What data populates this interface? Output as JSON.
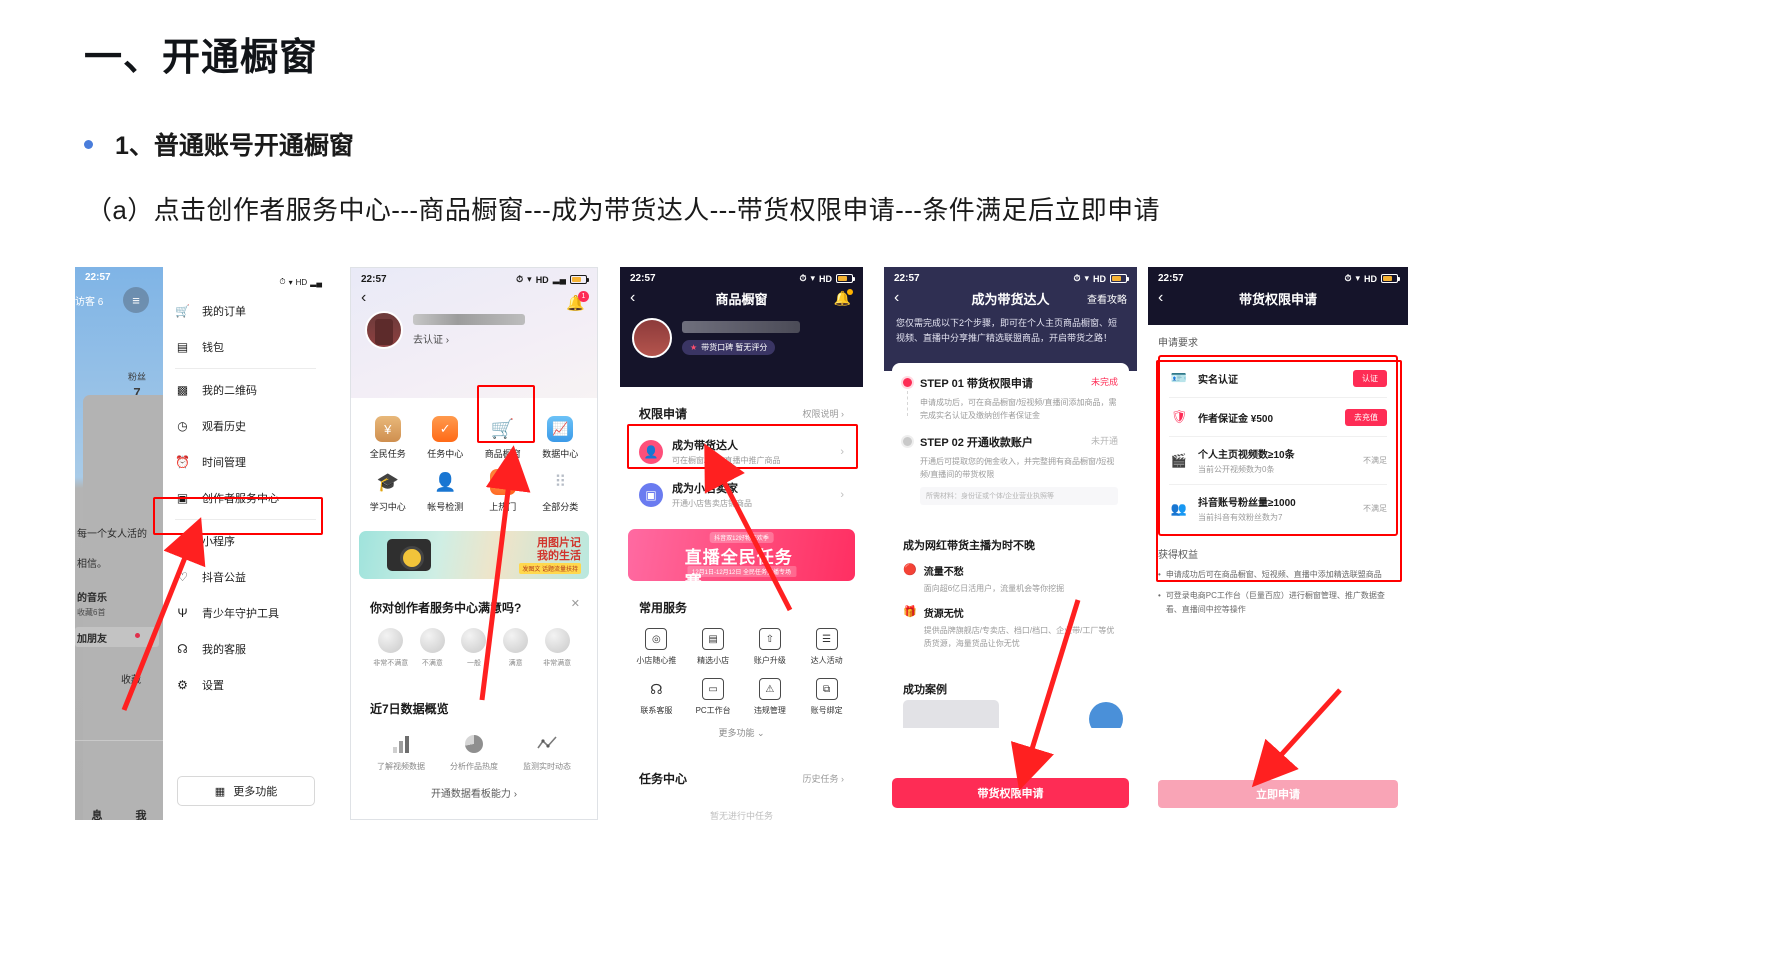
{
  "slide": {
    "title": "一、开通橱窗",
    "bullet": "1、普通账号开通橱窗",
    "subline": "（a）点击创作者服务中心---商品橱窗---成为带货达人---带货权限申请---条件满足后立即申请",
    "accent_color": "#ff0000",
    "bullet_dot_color": "#4a7ddb"
  },
  "phone1": {
    "status_time": "22:57",
    "status_icons": [
      "alarm-icon",
      "wifi-icon",
      "HD",
      "signal-icon",
      "battery-icon"
    ],
    "background": {
      "time": "22:57",
      "visitors": "访客 6",
      "fans_label": "粉丝",
      "fans_count": "7",
      "bio_line1": "每一个女人活的",
      "bio_line2": "相信。",
      "music_title": "的音乐",
      "music_sub": "收藏6首",
      "friends": "加朋友",
      "collect": "收藏",
      "tab_message": "息",
      "tab_me": "我"
    },
    "menu": [
      {
        "label": "我的订单",
        "icon": "cart-icon"
      },
      {
        "label": "钱包",
        "icon": "wallet-icon"
      },
      {
        "label": "我的二维码",
        "icon": "qrcode-icon"
      },
      {
        "label": "观看历史",
        "icon": "history-clock-icon"
      },
      {
        "label": "时间管理",
        "icon": "alarm-clock-icon"
      },
      {
        "label": "创作者服务中心",
        "icon": "chart-box-icon"
      },
      {
        "label": "小程序",
        "icon": "miniprogram-icon"
      },
      {
        "label": "抖音公益",
        "icon": "charity-icon"
      },
      {
        "label": "青少年守护工具",
        "icon": "sprout-icon"
      },
      {
        "label": "我的客服",
        "icon": "headset-icon"
      },
      {
        "label": "设置",
        "icon": "gear-icon"
      }
    ],
    "more_button": "更多功能",
    "more_button_icon": "grid-icon"
  },
  "phone2": {
    "status_time": "22:57",
    "back_icon": "chevron-left-icon",
    "bell_icon": "bell-icon",
    "bell_badge": "1",
    "verify_link": "去认证 ›",
    "grid": [
      {
        "label": "全民任务",
        "icon": "money-stack-icon",
        "color": "#d9a15e"
      },
      {
        "label": "任务中心",
        "icon": "task-check-icon",
        "color": "#ff7a2f"
      },
      {
        "label": "商品橱窗",
        "icon": "shopping-cart-icon",
        "color": "#ff8a1f"
      },
      {
        "label": "数据中心",
        "icon": "trend-chart-icon",
        "color": "#4aa8f0"
      },
      {
        "label": "学习中心",
        "icon": "graduation-cap-icon",
        "color": "#3c9de8"
      },
      {
        "label": "帐号检测",
        "icon": "user-search-icon",
        "color": "#f2b63c"
      },
      {
        "label": "上热门",
        "icon": "dou-plus-icon",
        "color": "#ff6a2a"
      },
      {
        "label": "全部分类",
        "icon": "dots-grid-icon",
        "color": "#b6bcc6"
      }
    ],
    "banner": {
      "line1": "用图片记",
      "line2": "我的生活",
      "tag": "发图文 话题流量扶持"
    },
    "survey": {
      "title": "你对创作者服务中心满意吗?",
      "close_icon": "close-icon",
      "options": [
        "非常不满意",
        "不满意",
        "一般",
        "满意",
        "非常满意"
      ]
    },
    "overview": {
      "title": "近7日数据概览",
      "items": [
        {
          "label": "了解视频数据",
          "icon": "bar-chart-icon"
        },
        {
          "label": "分析作品热度",
          "icon": "pie-chart-icon"
        },
        {
          "label": "监测实时动态",
          "icon": "line-chart-icon"
        }
      ],
      "action": "开通数据看板能力 ›"
    }
  },
  "phone3": {
    "status_time": "22:57",
    "title": "商品橱窗",
    "back_icon": "chevron-left-icon",
    "bell_icon": "bell-icon",
    "rating_chip": "带货口碑 暂无评分",
    "permission": {
      "title": "权限申请",
      "link": "权限说明 ›",
      "rows": [
        {
          "title": "成为带货达人",
          "sub": "可在橱窗/视频/直播中推广商品",
          "icon": "talent-user-icon",
          "color": "#fe4f7a"
        },
        {
          "title": "成为小店卖家",
          "sub": "开通小店售卖店铺商品",
          "icon": "shop-box-icon",
          "color": "#6a7bf0"
        }
      ]
    },
    "banner": {
      "tag": "抖音双12好物狂欢季",
      "title": "直播全民任务赛",
      "sub": "12月1日-12月12日 全民任务直播专场"
    },
    "services": {
      "title": "常用服务",
      "items": [
        {
          "label": "小店随心推",
          "icon": "promote-icon",
          "badge": true
        },
        {
          "label": "精选小店",
          "icon": "shop-icon"
        },
        {
          "label": "账户升级",
          "icon": "upgrade-icon"
        },
        {
          "label": "达人活动",
          "icon": "activity-icon"
        },
        {
          "label": "联系客服",
          "icon": "headset-icon"
        },
        {
          "label": "PC工作台",
          "icon": "desktop-icon"
        },
        {
          "label": "违规管理",
          "icon": "warning-doc-icon"
        },
        {
          "label": "账号绑定",
          "icon": "link-icon"
        }
      ],
      "more": "更多功能 ⌄"
    },
    "task_center": {
      "title": "任务中心",
      "link": "历史任务 ›",
      "empty": "暂无进行中任务"
    }
  },
  "phone4": {
    "status_time": "22:57",
    "title": "成为带货达人",
    "back_icon": "chevron-left-icon",
    "guide_link": "查看攻略",
    "intro": "您仅需完成以下2个步骤，即可在个人主页商品橱窗、短视频、直播中分享推广精选联盟商品，开启带货之路！",
    "steps": [
      {
        "title": "STEP 01 带货权限申请",
        "status": "未完成",
        "status_color": "#fe2c55",
        "body": "申请成功后，可在商品橱窗/短视频/直播间添加商品，需完成实名认证及缴纳创作者保证金",
        "note": ""
      },
      {
        "title": "STEP 02 开通收款账户",
        "status": "未开通",
        "status_color": "#b5b5b5",
        "body": "开通后可提取您的佣金收入，并完整拥有商品橱窗/短视频/直播间的带货权限",
        "note": "所需材料：身份证或个体/企业营业执照等"
      }
    ],
    "benefit_card": {
      "title": "成为网红带货主播为时不晚",
      "items": [
        {
          "icon": "flow-icon",
          "title": "流量不愁",
          "sub": "面向超6亿日活用户，流量机会等你挖掘"
        },
        {
          "icon": "goods-icon",
          "title": "货源无忧",
          "sub": "提供品牌旗舰店/专卖店、档口/档口、企业带/工厂等优质货源，海量货品让你无忧"
        }
      ]
    },
    "case_title": "成功案例",
    "cta": "带货权限申请"
  },
  "phone5": {
    "status_time": "22:57",
    "title": "带货权限申请",
    "back_icon": "chevron-left-icon",
    "section_label": "申请要求",
    "requirements": [
      {
        "icon": "id-card-icon",
        "title": "实名认证",
        "sub": "",
        "action": "认证",
        "action_type": "button"
      },
      {
        "icon": "shield-icon",
        "title": "作者保证金 ¥500",
        "sub": "",
        "action": "去充值",
        "action_type": "button"
      },
      {
        "icon": "video-icon",
        "title": "个人主页视频数≥10条",
        "sub": "当前公开视频数为0条",
        "action": "不满足",
        "action_type": "status"
      },
      {
        "icon": "fans-icon",
        "title": "抖音账号粉丝量≥1000",
        "sub": "当前抖音有效粉丝数为7",
        "action": "不满足",
        "action_type": "status"
      }
    ],
    "benefits_label": "获得权益",
    "benefits": [
      "申请成功后可在商品橱窗、短视频、直播中添加精选联盟商品",
      "可登录电商PC工作台（巨量百应）进行橱窗管理、推广数据查看、直播间中控等操作"
    ],
    "cta": "立即申请"
  }
}
